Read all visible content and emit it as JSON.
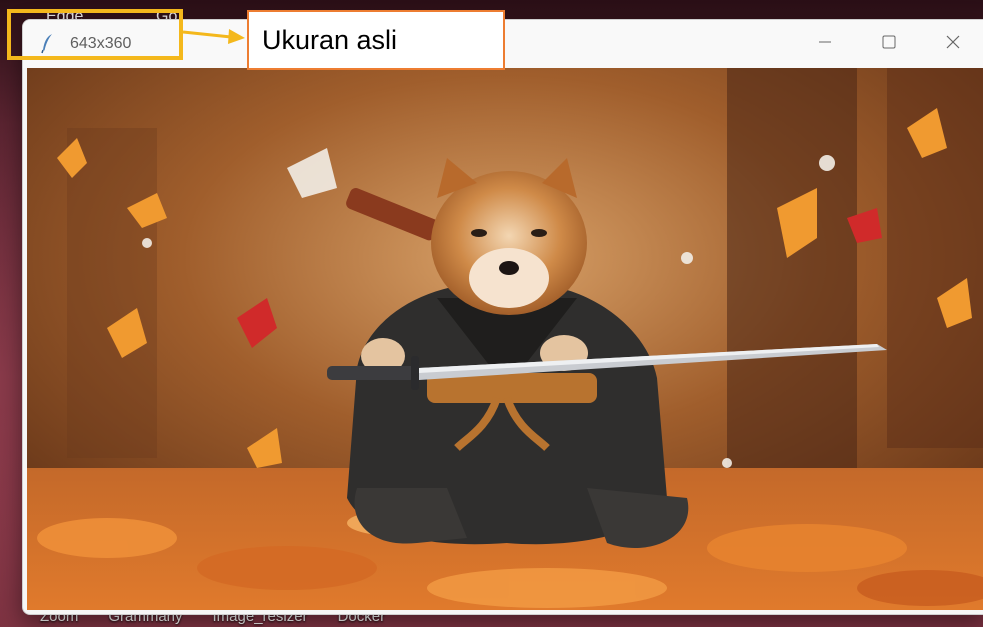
{
  "desktop": {
    "top_labels": [
      "Edge",
      "Go"
    ],
    "taskbar_labels": [
      "Zoom",
      "Grammarly",
      "Image_resizer",
      "Docker"
    ]
  },
  "window": {
    "title": "643x360",
    "icon": "feather-icon",
    "controls": {
      "minimize": "minimize-icon",
      "maximize": "maximize-icon",
      "close": "close-icon"
    }
  },
  "content": {
    "image": "shiba-inu-samurai-autumn-photo"
  },
  "annotation": {
    "callout_text": "Ukuran asli",
    "highlight_color": "#f4b81c",
    "callout_border_color": "#ed7d31"
  }
}
